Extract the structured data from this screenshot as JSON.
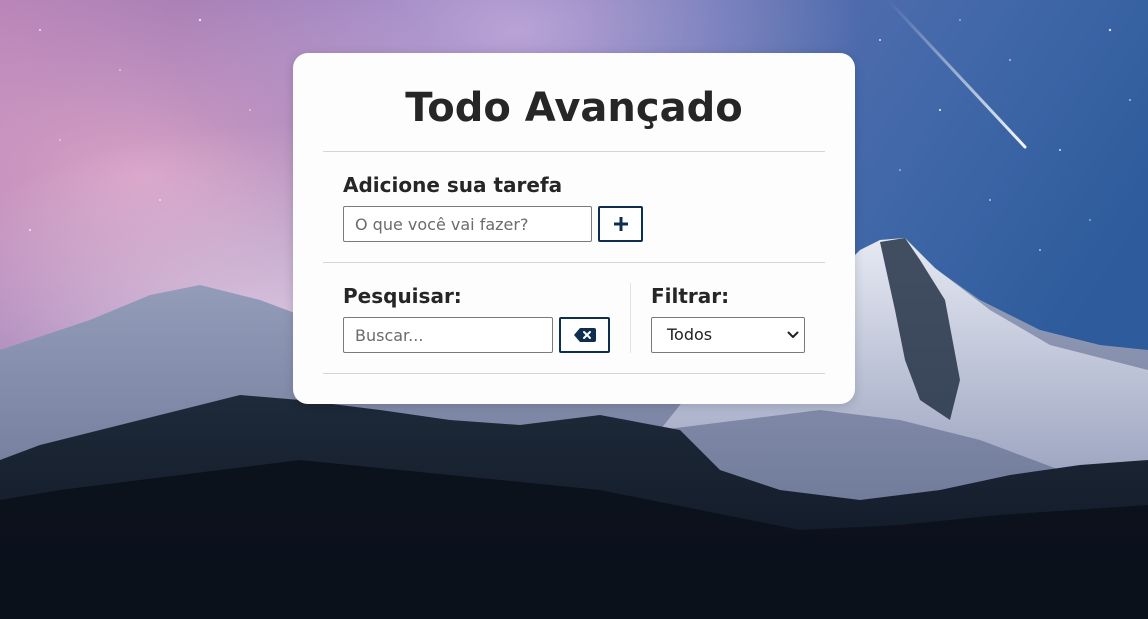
{
  "app": {
    "title": "Todo Avançado"
  },
  "add_section": {
    "label": "Adicione sua tarefa",
    "input_placeholder": "O que você vai fazer?",
    "add_button_icon": "plus-icon"
  },
  "search_section": {
    "label": "Pesquisar:",
    "input_placeholder": "Buscar...",
    "erase_button_icon": "backspace-icon"
  },
  "filter_section": {
    "label": "Filtrar:",
    "selected": "Todos"
  },
  "colors": {
    "accent": "#0e2e4d",
    "card_bg": "#fdfdfd",
    "text": "#262626"
  }
}
